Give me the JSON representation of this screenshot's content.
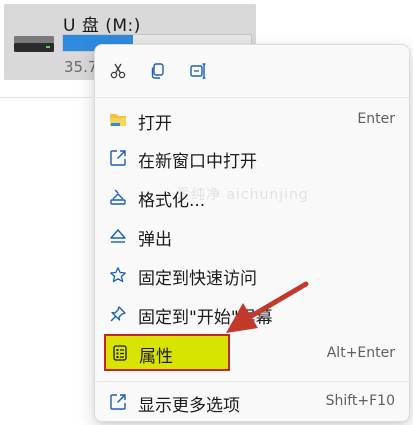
{
  "drive": {
    "title": "U 盘 (M:)",
    "size_text": "35.7",
    "usage_fraction": 0.37,
    "usage_color": "#2f8be0"
  },
  "quick_actions": [
    {
      "icon": "cut-icon"
    },
    {
      "icon": "copy-icon"
    },
    {
      "icon": "rename-icon"
    }
  ],
  "menu": {
    "items": [
      {
        "label": "打开",
        "shortcut": "Enter",
        "icon": "folder-icon"
      },
      {
        "label": "在新窗口中打开",
        "shortcut": "",
        "icon": "open-new-window-icon"
      },
      {
        "label": "格式化...",
        "shortcut": "",
        "icon": "format-icon"
      },
      {
        "label": "弹出",
        "shortcut": "",
        "icon": "eject-icon"
      },
      {
        "label": "固定到快速访问",
        "shortcut": "",
        "icon": "star-icon"
      },
      {
        "label": "固定到\"开始\"屏幕",
        "shortcut": "",
        "icon": "pin-icon"
      },
      {
        "label": "属性",
        "shortcut": "Alt+Enter",
        "icon": "properties-icon"
      },
      {
        "label": "显示更多选项",
        "shortcut": "Shift+F10",
        "icon": "more-options-icon"
      }
    ]
  },
  "watermark": "爱纯净 aichunjing",
  "colors": {
    "highlight_fill": "#d9e300",
    "highlight_border": "#c0262c",
    "arrow": "#c0392b",
    "accent_icon": "#1a5fb4"
  }
}
